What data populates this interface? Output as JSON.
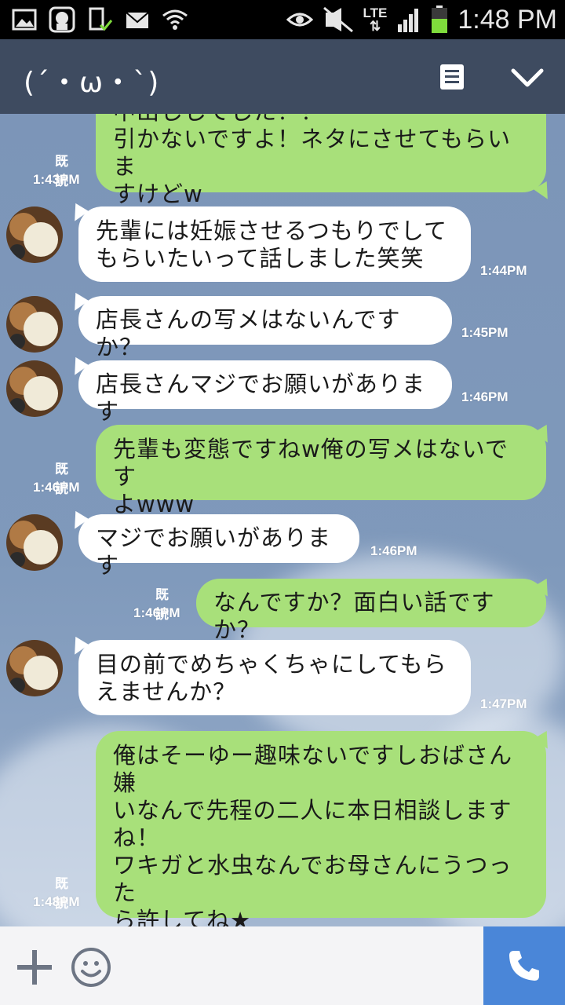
{
  "status_bar": {
    "time": "1:48 PM",
    "network": "LTE",
    "icons": [
      "gallery-icon",
      "character-icon",
      "sim-icon",
      "mail-icon",
      "wifi-icon",
      "eye-icon",
      "mute-icon",
      "signal-icon",
      "battery-icon"
    ]
  },
  "header": {
    "title": "(´・ω・`)",
    "icons": [
      "memo-icon",
      "chevron-down-icon"
    ]
  },
  "messages": [
    {
      "side": "out",
      "text": "中出ししてした？？\n引かないですよ！ネタにさせてもらいま\nすけどw",
      "read": "既読",
      "time": "1:43PM"
    },
    {
      "side": "in",
      "text": "先輩には妊娠させるつもりでして\nもらいたいって話しました笑笑",
      "time": "1:44PM"
    },
    {
      "side": "in",
      "text": "店長さんの写メはないんですか？",
      "time": "1:45PM"
    },
    {
      "side": "in",
      "text": "店長さんマジでお願いがあります",
      "time": "1:46PM"
    },
    {
      "side": "out",
      "text": "先輩も変態ですねw俺の写メはないです\nよwww",
      "read": "既読",
      "time": "1:46PM"
    },
    {
      "side": "in",
      "text": "マジでお願いがあります",
      "time": "1:46PM"
    },
    {
      "side": "out",
      "text": "なんですか？面白い話ですか？",
      "read": "既読",
      "time": "1:46PM"
    },
    {
      "side": "in",
      "text": "目の前でめちゃくちゃにしてもら\nえませんか？",
      "time": "1:47PM"
    },
    {
      "side": "out",
      "text": "俺はそーゆー趣味ないですしおばさん嫌\nいなんで先程の二人に本日相談します\nね！\nワキガと水虫なんでお母さんにうつった\nら許してね★\n性病はもう治ってると思うので！",
      "read": "既読",
      "time": "1:48PM"
    }
  ],
  "input_bar": {
    "icons": [
      "plus-icon",
      "emoji-icon",
      "phone-icon"
    ]
  },
  "colors": {
    "header_bg": "#3e4b60",
    "chat_bg": "#7e96b8",
    "bubble_out": "#a8e07a",
    "bubble_in": "#ffffff",
    "call_button": "#4a86d8"
  }
}
